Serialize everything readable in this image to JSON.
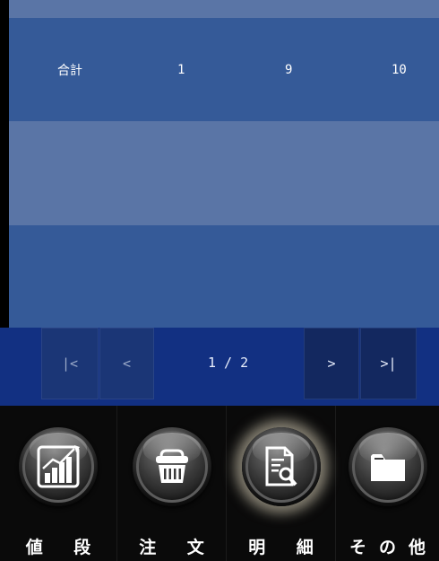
{
  "summary_row": {
    "label": "合計",
    "col1": "1",
    "col2": "9",
    "col3": "10"
  },
  "pager": {
    "first_label": "|<",
    "prev_label": "<",
    "page_label": "1 / 2",
    "next_label": ">",
    "last_label": ">|"
  },
  "nav": {
    "items": [
      {
        "label": "値 段",
        "icon": "chart-icon"
      },
      {
        "label": "注 文",
        "icon": "basket-icon"
      },
      {
        "label": "明 細",
        "icon": "document-search-icon"
      },
      {
        "label": "その他",
        "icon": "folder-icon"
      }
    ],
    "active_index": 2
  },
  "colors": {
    "row_dark": "#355a98",
    "row_light": "#5a75a6",
    "pager_bg": "#123082",
    "nav_bg": "#0a0a0a"
  }
}
